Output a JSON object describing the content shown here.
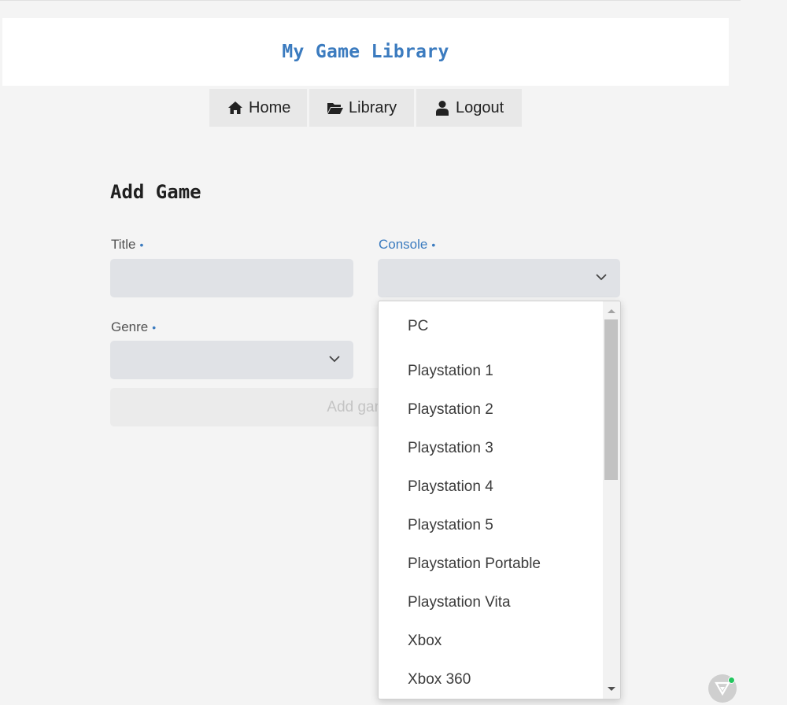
{
  "header": {
    "title": "My Game Library"
  },
  "nav": {
    "home_label": "Home",
    "library_label": "Library",
    "logout_label": "Logout"
  },
  "form": {
    "heading": "Add Game",
    "title_label": "Title",
    "title_value": "",
    "console_label": "Console",
    "console_value": "",
    "genre_label": "Genre",
    "genre_value": "",
    "required_marker": "•",
    "submit_label": "Add game t"
  },
  "console_options": [
    "PC",
    "Playstation 1",
    "Playstation 2",
    "Playstation 3",
    "Playstation 4",
    "Playstation 5",
    "Playstation Portable",
    "Playstation Vita",
    "Xbox",
    "Xbox 360"
  ],
  "colors": {
    "accent": "#3b7bbf",
    "input_bg": "#e0e2e6",
    "page_bg": "#f4f4f4",
    "status_dot": "#22c55e"
  },
  "icons": {
    "home": "home-icon",
    "library": "folder-open-icon",
    "logout": "user-icon",
    "select": "chevron-down-icon"
  }
}
